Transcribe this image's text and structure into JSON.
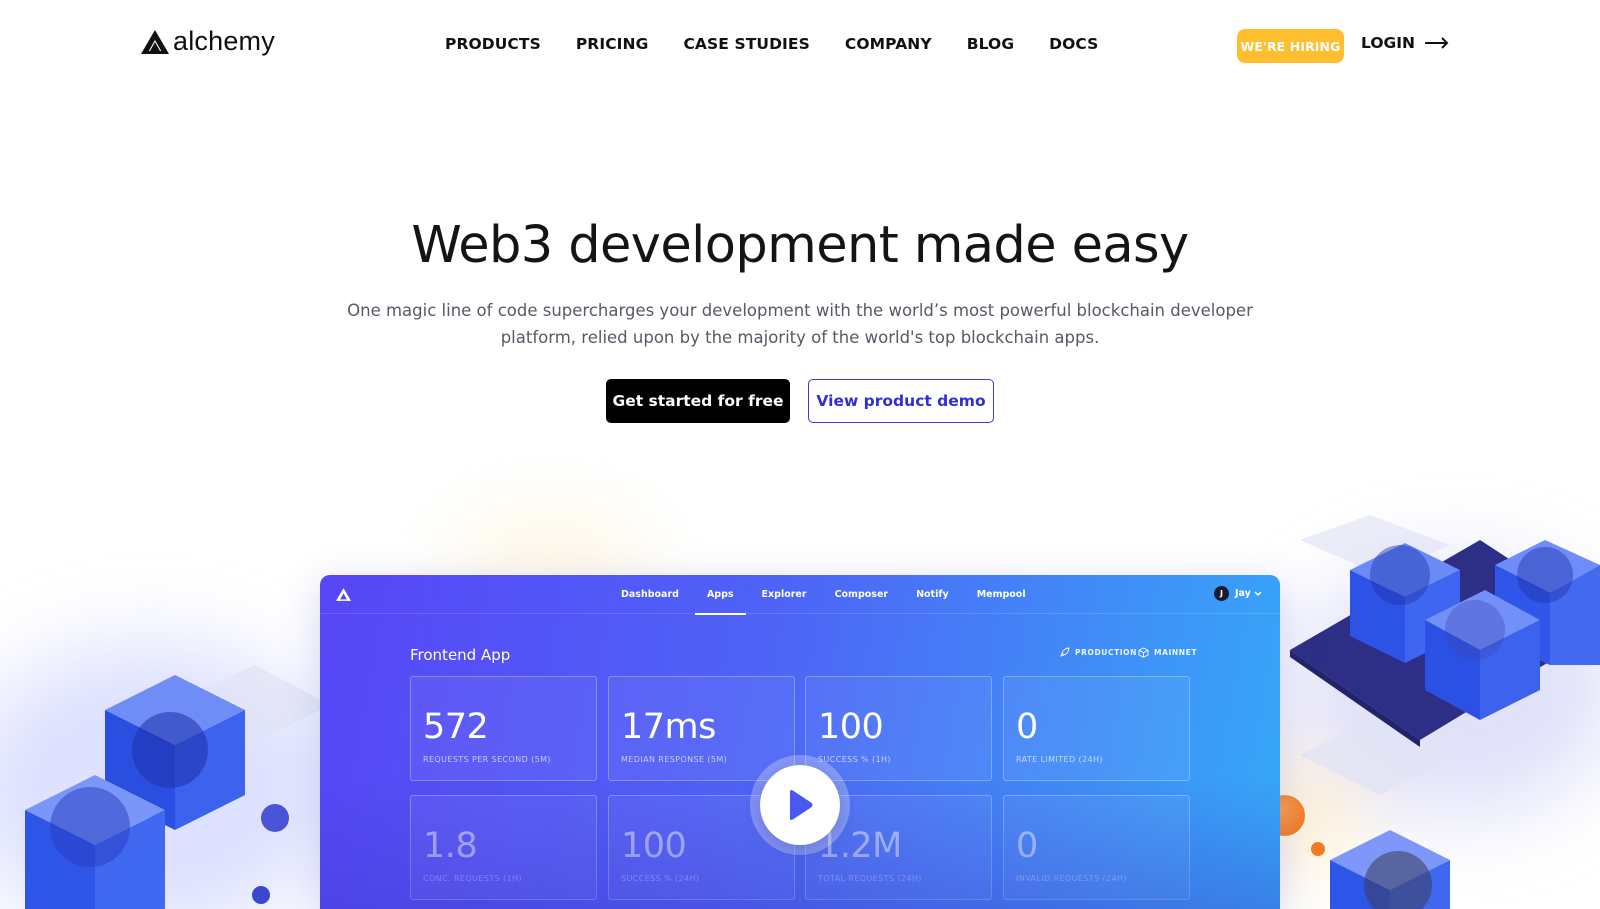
{
  "brand": {
    "name": "alchemy"
  },
  "nav": {
    "links": [
      "PRODUCTS",
      "PRICING",
      "CASE STUDIES",
      "COMPANY",
      "BLOG",
      "DOCS"
    ],
    "hiring_label": "WE'RE HIRING",
    "login_label": "LOGIN"
  },
  "hero": {
    "title": "Web3 development made easy",
    "subtitle_line1": "One magic line of code supercharges your development with the world’s most powerful blockchain developer",
    "subtitle_line2": "platform, relied upon by the majority of the world's top blockchain apps.",
    "cta_primary": "Get started for free",
    "cta_secondary": "View product demo"
  },
  "dashboard": {
    "tabs": [
      "Dashboard",
      "Apps",
      "Explorer",
      "Composer",
      "Notify",
      "Mempool"
    ],
    "active_tab": "Apps",
    "user_initial": "J",
    "user_name": "Jay",
    "app_title": "Frontend App",
    "env_production": "PRODUCTION",
    "env_network": "MAINNET",
    "metrics": [
      {
        "value": "572",
        "label": "REQUESTS PER SECOND (5M)"
      },
      {
        "value": "17ms",
        "label": "MEDIAN RESPONSE (5M)"
      },
      {
        "value": "100",
        "label": "SUCCESS % (1H)"
      },
      {
        "value": "0",
        "label": "RATE LIMITED (24H)"
      },
      {
        "value": "1.8",
        "label": "CONC. REQUESTS (1H)"
      },
      {
        "value": "100",
        "label": "SUCCESS % (24H)"
      },
      {
        "value": "1.2M",
        "label": "TOTAL REQUESTS (24H)"
      },
      {
        "value": "0",
        "label": "INVALID REQUESTS (24H)"
      }
    ]
  },
  "colors": {
    "hiring_bg": "#ffbe2e",
    "secondary_btn": "#2e2fd6",
    "dash_gradient_start": "#5746f6",
    "dash_gradient_end": "#36a9f8",
    "accent_orange": "#f47b20"
  },
  "icons": [
    "alchemy-logo-icon",
    "arrow-right-icon",
    "rocket-icon",
    "cube-icon",
    "play-icon",
    "chevron-down-icon"
  ]
}
